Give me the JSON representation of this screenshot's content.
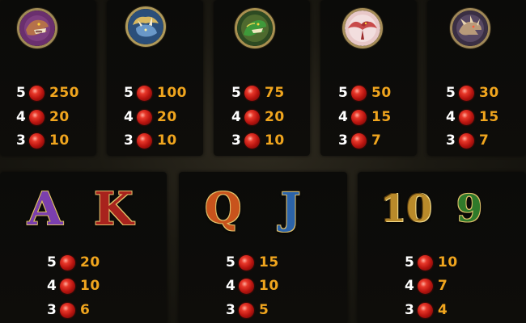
{
  "high_symbols": [
    {
      "icon": "t-rex-icon",
      "accent": "#7a3a7a",
      "pays": [
        {
          "count": "5",
          "value": "250"
        },
        {
          "count": "4",
          "value": "20"
        },
        {
          "count": "3",
          "value": "10"
        }
      ]
    },
    {
      "icon": "triceratops-icon",
      "accent": "#3a6fb0",
      "pays": [
        {
          "count": "5",
          "value": "100"
        },
        {
          "count": "4",
          "value": "20"
        },
        {
          "count": "3",
          "value": "10"
        }
      ]
    },
    {
      "icon": "green-raptor-icon",
      "accent": "#3e8a2a",
      "pays": [
        {
          "count": "5",
          "value": "75"
        },
        {
          "count": "4",
          "value": "20"
        },
        {
          "count": "3",
          "value": "10"
        }
      ]
    },
    {
      "icon": "pterodactyl-icon",
      "accent": "#c86a6a",
      "pays": [
        {
          "count": "5",
          "value": "50"
        },
        {
          "count": "4",
          "value": "15"
        },
        {
          "count": "3",
          "value": "7"
        }
      ]
    },
    {
      "icon": "fossil-dragon-icon",
      "accent": "#8a6a9a",
      "pays": [
        {
          "count": "5",
          "value": "30"
        },
        {
          "count": "4",
          "value": "15"
        },
        {
          "count": "3",
          "value": "7"
        }
      ]
    }
  ],
  "low_symbols": [
    {
      "letters": [
        {
          "text": "A",
          "style": "purple",
          "color": "#7b3fae"
        },
        {
          "text": "K",
          "style": "red",
          "color": "#a8231d"
        }
      ],
      "pays": [
        {
          "count": "5",
          "value": "20"
        },
        {
          "count": "4",
          "value": "10"
        },
        {
          "count": "3",
          "value": "6"
        }
      ]
    },
    {
      "letters": [
        {
          "text": "Q",
          "style": "orange",
          "color": "#c8531c"
        },
        {
          "text": "J",
          "style": "blue",
          "color": "#2b63a8"
        }
      ],
      "pays": [
        {
          "count": "5",
          "value": "15"
        },
        {
          "count": "4",
          "value": "10"
        },
        {
          "count": "3",
          "value": "5"
        }
      ]
    },
    {
      "letters": [
        {
          "text": "10",
          "style": "gold",
          "color": "#b98a2a"
        },
        {
          "text": "9",
          "style": "green",
          "color": "#2f7a2a"
        }
      ],
      "pays": [
        {
          "count": "5",
          "value": "10"
        },
        {
          "count": "4",
          "value": "7"
        },
        {
          "count": "3",
          "value": "4"
        }
      ]
    }
  ],
  "colors": {
    "value_text": "#f0a51e",
    "count_text": "#ffffff",
    "gem": "#d8261c",
    "panel": "#0b0b09"
  },
  "coin_icon": "ruby-gem-icon"
}
